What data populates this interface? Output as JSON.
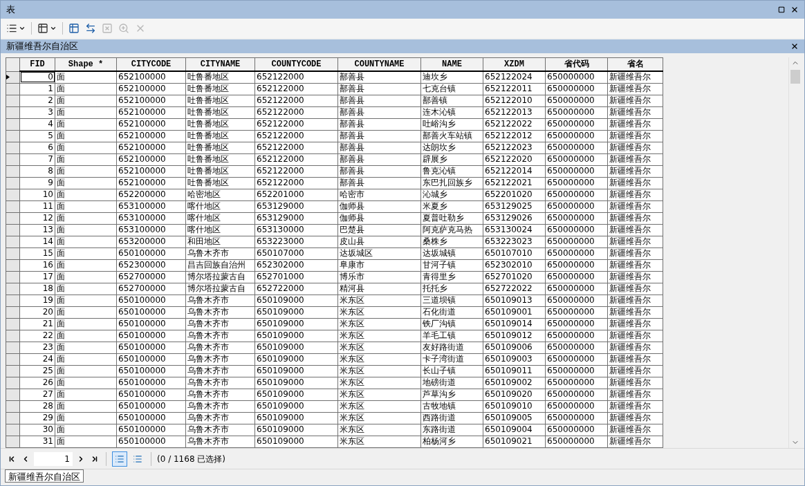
{
  "window": {
    "title": "表"
  },
  "toolbar": [
    {
      "dropdown": true,
      "disabled": false
    },
    {
      "dropdown": true,
      "disabled": false
    },
    {
      "dropdown": false,
      "disabled": false
    },
    {
      "dropdown": false,
      "disabled": false
    },
    {
      "dropdown": false,
      "disabled": true
    },
    {
      "dropdown": false,
      "disabled": true
    },
    {
      "dropdown": false,
      "disabled": true
    }
  ],
  "table_title": "新疆维吾尔自治区",
  "table": {
    "columns": [
      "FID",
      "Shape *",
      "CITYCODE",
      "CITYNAME",
      "COUNTYCODE",
      "COUNTYNAME",
      "NAME",
      "XZDM",
      "省代码",
      "省名"
    ],
    "rows": [
      {
        "current": true,
        "cells": [
          "0",
          "面",
          "652100000",
          "吐鲁番地区",
          "652122000",
          "鄯善县",
          "迪坎乡",
          "652122024",
          "650000000",
          "新疆维吾尔"
        ]
      },
      {
        "current": false,
        "cells": [
          "1",
          "面",
          "652100000",
          "吐鲁番地区",
          "652122000",
          "鄯善县",
          "七克台镇",
          "652122011",
          "650000000",
          "新疆维吾尔"
        ]
      },
      {
        "current": false,
        "cells": [
          "2",
          "面",
          "652100000",
          "吐鲁番地区",
          "652122000",
          "鄯善县",
          "鄯善镇",
          "652122010",
          "650000000",
          "新疆维吾尔"
        ]
      },
      {
        "current": false,
        "cells": [
          "3",
          "面",
          "652100000",
          "吐鲁番地区",
          "652122000",
          "鄯善县",
          "连木沁镇",
          "652122013",
          "650000000",
          "新疆维吾尔"
        ]
      },
      {
        "current": false,
        "cells": [
          "4",
          "面",
          "652100000",
          "吐鲁番地区",
          "652122000",
          "鄯善县",
          "吐峪沟乡",
          "652122022",
          "650000000",
          "新疆维吾尔"
        ]
      },
      {
        "current": false,
        "cells": [
          "5",
          "面",
          "652100000",
          "吐鲁番地区",
          "652122000",
          "鄯善县",
          "鄯善火车站镇",
          "652122012",
          "650000000",
          "新疆维吾尔"
        ]
      },
      {
        "current": false,
        "cells": [
          "6",
          "面",
          "652100000",
          "吐鲁番地区",
          "652122000",
          "鄯善县",
          "达朗坎乡",
          "652122023",
          "650000000",
          "新疆维吾尔"
        ]
      },
      {
        "current": false,
        "cells": [
          "7",
          "面",
          "652100000",
          "吐鲁番地区",
          "652122000",
          "鄯善县",
          "辟展乡",
          "652122020",
          "650000000",
          "新疆维吾尔"
        ]
      },
      {
        "current": false,
        "cells": [
          "8",
          "面",
          "652100000",
          "吐鲁番地区",
          "652122000",
          "鄯善县",
          "鲁克沁镇",
          "652122014",
          "650000000",
          "新疆维吾尔"
        ]
      },
      {
        "current": false,
        "cells": [
          "9",
          "面",
          "652100000",
          "吐鲁番地区",
          "652122000",
          "鄯善县",
          "东巴扎回族乡",
          "652122021",
          "650000000",
          "新疆维吾尔"
        ]
      },
      {
        "current": false,
        "cells": [
          "10",
          "面",
          "652200000",
          "哈密地区",
          "652201000",
          "哈密市",
          "沁城乡",
          "652201020",
          "650000000",
          "新疆维吾尔"
        ]
      },
      {
        "current": false,
        "cells": [
          "11",
          "面",
          "653100000",
          "喀什地区",
          "653129000",
          "伽师县",
          "米夏乡",
          "653129025",
          "650000000",
          "新疆维吾尔"
        ]
      },
      {
        "current": false,
        "cells": [
          "12",
          "面",
          "653100000",
          "喀什地区",
          "653129000",
          "伽师县",
          "夏普吐勒乡",
          "653129026",
          "650000000",
          "新疆维吾尔"
        ]
      },
      {
        "current": false,
        "cells": [
          "13",
          "面",
          "653100000",
          "喀什地区",
          "653130000",
          "巴楚县",
          "阿克萨克马热",
          "653130024",
          "650000000",
          "新疆维吾尔"
        ]
      },
      {
        "current": false,
        "cells": [
          "14",
          "面",
          "653200000",
          "和田地区",
          "653223000",
          "皮山县",
          "桑株乡",
          "653223023",
          "650000000",
          "新疆维吾尔"
        ]
      },
      {
        "current": false,
        "cells": [
          "15",
          "面",
          "650100000",
          "乌鲁木齐市",
          "650107000",
          "达坂城区",
          "达坂城镇",
          "650107010",
          "650000000",
          "新疆维吾尔"
        ]
      },
      {
        "current": false,
        "cells": [
          "16",
          "面",
          "652300000",
          "昌吉回族自治州",
          "652302000",
          "阜康市",
          "甘河子镇",
          "652302010",
          "650000000",
          "新疆维吾尔"
        ]
      },
      {
        "current": false,
        "cells": [
          "17",
          "面",
          "652700000",
          "博尔塔拉蒙古自",
          "652701000",
          "博乐市",
          "青得里乡",
          "652701020",
          "650000000",
          "新疆维吾尔"
        ]
      },
      {
        "current": false,
        "cells": [
          "18",
          "面",
          "652700000",
          "博尔塔拉蒙古自",
          "652722000",
          "精河县",
          "托托乡",
          "652722022",
          "650000000",
          "新疆维吾尔"
        ]
      },
      {
        "current": false,
        "cells": [
          "19",
          "面",
          "650100000",
          "乌鲁木齐市",
          "650109000",
          "米东区",
          "三道坝镇",
          "650109013",
          "650000000",
          "新疆维吾尔"
        ]
      },
      {
        "current": false,
        "cells": [
          "20",
          "面",
          "650100000",
          "乌鲁木齐市",
          "650109000",
          "米东区",
          "石化街道",
          "650109001",
          "650000000",
          "新疆维吾尔"
        ]
      },
      {
        "current": false,
        "cells": [
          "21",
          "面",
          "650100000",
          "乌鲁木齐市",
          "650109000",
          "米东区",
          "铁厂沟镇",
          "650109014",
          "650000000",
          "新疆维吾尔"
        ]
      },
      {
        "current": false,
        "cells": [
          "22",
          "面",
          "650100000",
          "乌鲁木齐市",
          "650109000",
          "米东区",
          "羊毛工镇",
          "650109012",
          "650000000",
          "新疆维吾尔"
        ]
      },
      {
        "current": false,
        "cells": [
          "23",
          "面",
          "650100000",
          "乌鲁木齐市",
          "650109000",
          "米东区",
          "友好路街道",
          "650109006",
          "650000000",
          "新疆维吾尔"
        ]
      },
      {
        "current": false,
        "cells": [
          "24",
          "面",
          "650100000",
          "乌鲁木齐市",
          "650109000",
          "米东区",
          "卡子湾街道",
          "650109003",
          "650000000",
          "新疆维吾尔"
        ]
      },
      {
        "current": false,
        "cells": [
          "25",
          "面",
          "650100000",
          "乌鲁木齐市",
          "650109000",
          "米东区",
          "长山子镇",
          "650109011",
          "650000000",
          "新疆维吾尔"
        ]
      },
      {
        "current": false,
        "cells": [
          "26",
          "面",
          "650100000",
          "乌鲁木齐市",
          "650109000",
          "米东区",
          "地磅街道",
          "650109002",
          "650000000",
          "新疆维吾尔"
        ]
      },
      {
        "current": false,
        "cells": [
          "27",
          "面",
          "650100000",
          "乌鲁木齐市",
          "650109000",
          "米东区",
          "芦草沟乡",
          "650109020",
          "650000000",
          "新疆维吾尔"
        ]
      },
      {
        "current": false,
        "cells": [
          "28",
          "面",
          "650100000",
          "乌鲁木齐市",
          "650109000",
          "米东区",
          "古牧地镇",
          "650109010",
          "650000000",
          "新疆维吾尔"
        ]
      },
      {
        "current": false,
        "cells": [
          "29",
          "面",
          "650100000",
          "乌鲁木齐市",
          "650109000",
          "米东区",
          "西路街道",
          "650109005",
          "650000000",
          "新疆维吾尔"
        ]
      },
      {
        "current": false,
        "cells": [
          "30",
          "面",
          "650100000",
          "乌鲁木齐市",
          "650109000",
          "米东区",
          "东路街道",
          "650109004",
          "650000000",
          "新疆维吾尔"
        ]
      },
      {
        "current": false,
        "cells": [
          "31",
          "面",
          "650100000",
          "乌鲁木齐市",
          "650109000",
          "米东区",
          "柏杨河乡",
          "650109021",
          "650000000",
          "新疆维吾尔"
        ]
      }
    ]
  },
  "navigator": {
    "record": "1",
    "views": [
      {
        "selected": true
      },
      {
        "selected": false
      }
    ],
    "status": "(0 / 1168 已选择)"
  },
  "tabs": [
    {
      "label": "新疆维吾尔自治区",
      "selected": true
    }
  ]
}
